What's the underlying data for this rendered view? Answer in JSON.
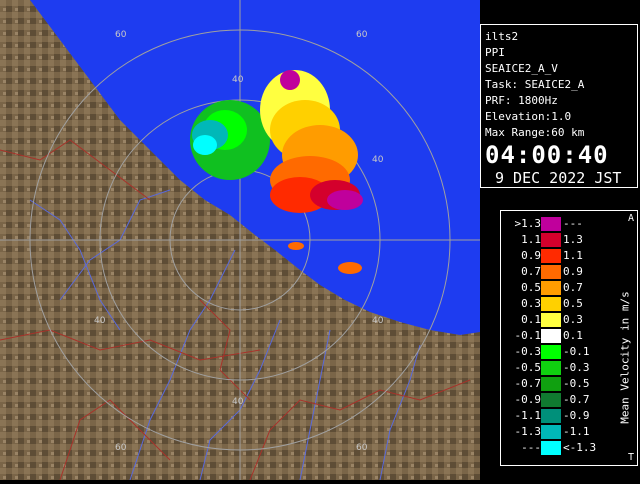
{
  "radar": {
    "site": "ilts2",
    "mode": "PPI",
    "product": "SEAICE2_A_V",
    "task": "Task: SEAICE2_A",
    "prf": "PRF: 1800Hz",
    "elevation": "Elevation:1.0",
    "max_range": "Max Range:60 km",
    "time": "04:00:40",
    "date": "9 DEC 2022 JST"
  },
  "range_labels": {
    "r40_top": "40",
    "r40_right": "40",
    "r40_left": "40",
    "r40_bottom": "40",
    "r40_right2": "40",
    "r60_top": "60",
    "r60_bottom": "60",
    "r60_topright": "60",
    "r60_bottomright": "60"
  },
  "legend": {
    "title": "Mean Velocity in m/s",
    "corner_top": "A",
    "corner_bottom": "T",
    "rows": [
      {
        "a": ">1.3",
        "b": "---",
        "color": "#c0009c"
      },
      {
        "a": "1.1",
        "b": "1.3",
        "color": "#d4002c"
      },
      {
        "a": "0.9",
        "b": "1.1",
        "color": "#ff2a00"
      },
      {
        "a": "0.7",
        "b": "0.9",
        "color": "#ff6a00"
      },
      {
        "a": "0.5",
        "b": "0.7",
        "color": "#ff9c00"
      },
      {
        "a": "0.3",
        "b": "0.5",
        "color": "#ffd000"
      },
      {
        "a": "0.1",
        "b": "0.3",
        "color": "#ffff40"
      },
      {
        "a": "-0.1",
        "b": "0.1",
        "color": "#ffffff"
      },
      {
        "a": "-0.3",
        "b": "-0.1",
        "color": "#00ff00"
      },
      {
        "a": "-0.5",
        "b": "-0.3",
        "color": "#10d010"
      },
      {
        "a": "-0.7",
        "b": "-0.5",
        "color": "#10a010"
      },
      {
        "a": "-0.9",
        "b": "-0.7",
        "color": "#107a30"
      },
      {
        "a": "-1.1",
        "b": "-0.9",
        "color": "#00907a"
      },
      {
        "a": "-1.3",
        "b": "-1.1",
        "color": "#00b8b8"
      },
      {
        "a": "---",
        "b": "<-1.3",
        "color": "#00ffff"
      }
    ]
  },
  "colors": {
    "sea": "#1e3cf0",
    "land": "#7a6548",
    "rivers": "#5a6adc",
    "borders": "#a8322a",
    "rings": "#a0a0a0"
  }
}
